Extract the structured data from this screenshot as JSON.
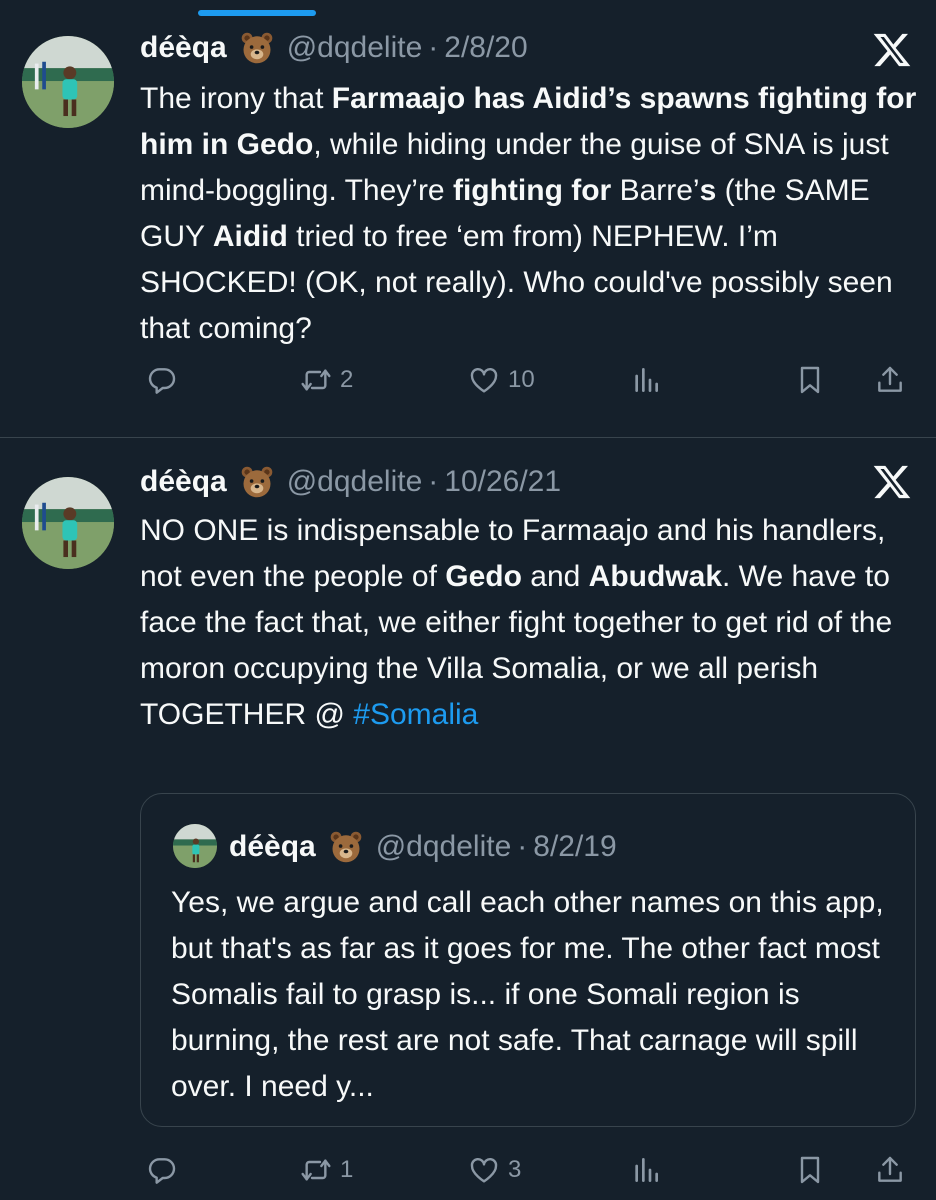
{
  "colors": {
    "background": "#15202b",
    "text": "#f7f9f9",
    "muted": "#8b98a5",
    "accent": "#1d9bf0",
    "border": "#38444d"
  },
  "tweets": [
    {
      "name": "déèqa",
      "handle": "@dqdelite",
      "separator": "·",
      "date": "2/8/20",
      "icons": {
        "emoji": "bear-emoji-icon",
        "platform": "x-logo-icon"
      },
      "text_parts": [
        "The irony that ",
        "Farmaajo has Aidid’s spawns fighting for him in Gedo",
        ", while hiding under the guise of SNA is just mind-boggling. They’re ",
        "fighting for",
        " Barre’",
        "s",
        " (the SAME GUY ",
        "Aidid",
        " tried to free ‘em from) NEPHEW. I’m SHOCKED! (OK, not really). Who could've possibly seen that coming?"
      ],
      "actions": {
        "replies": "",
        "retweets": "2",
        "likes": "10"
      }
    },
    {
      "name": "déèqa",
      "handle": "@dqdelite",
      "separator": "·",
      "date": "10/26/21",
      "icons": {
        "emoji": "bear-emoji-icon",
        "platform": "x-logo-icon"
      },
      "text_parts": [
        "NO ONE is indispensable to Farmaajo and his handlers, not even the people of ",
        "Gedo",
        " and ",
        "Abudwak",
        ". We have to face the fact that, we either fight together to get rid of the moron occupying the Villa Somalia, or we all perish TOGETHER @ ",
        "#Somalia"
      ],
      "quote": {
        "name": "déèqa",
        "handle": "@dqdelite",
        "separator": "·",
        "date": "8/2/19",
        "text": "Yes, we argue and call each other names on this app, but that's as far as it goes for me. The other fact most Somalis fail to grasp is... if one Somali region is burning, the rest are not safe. That carnage will spill over. I need y..."
      },
      "actions": {
        "replies": "",
        "retweets": "1",
        "likes": "3"
      }
    }
  ]
}
